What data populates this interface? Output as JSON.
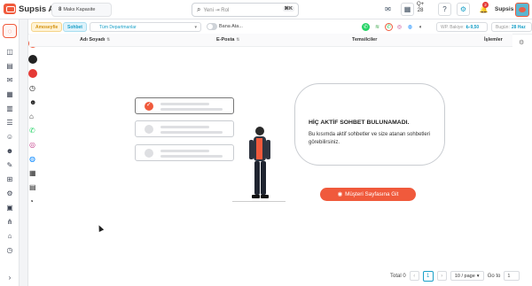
{
  "app": {
    "name": "Supsis Ai"
  },
  "topbar": {
    "capacity_value": "8",
    "capacity_label": "Maks Kapasite",
    "search_placeholder": "Yeni ⇥ Rol",
    "search_shortcut": "⌘K",
    "counter_value": "28",
    "username": "Supsis",
    "notification_count": "2"
  },
  "filters": {
    "status_chip": "Amoseyfie",
    "sohbet_chip": "Sohbet",
    "department_select": "Tüm Departmanlar",
    "assign_toggle_label": "Bana Ata...",
    "wp_label": "WP. Bakiye:",
    "wp_value": "₺-9,50",
    "today_label": "Bugün:",
    "today_value": "28 Haz"
  },
  "table": {
    "columns": [
      "Adı Soyadı",
      "E-Posta",
      "Temsilciler",
      "İşlemler"
    ]
  },
  "empty_state": {
    "title": "HİÇ AKTİF SOHBET BULUNAMADI.",
    "description": "Bu kısımda aktif sohbetler ve size atanan sohbetleri görebilirsiniz.",
    "button_label": "Müşteri Sayfasına Git"
  },
  "pagination": {
    "total_label": "Total 0",
    "current_page": "1",
    "page_size": "10 / page",
    "goto_label": "Go to",
    "goto_value": "1"
  },
  "colors": {
    "accent": "#f05a3c",
    "link": "#1aa0c8",
    "amber": "#d4920f"
  }
}
